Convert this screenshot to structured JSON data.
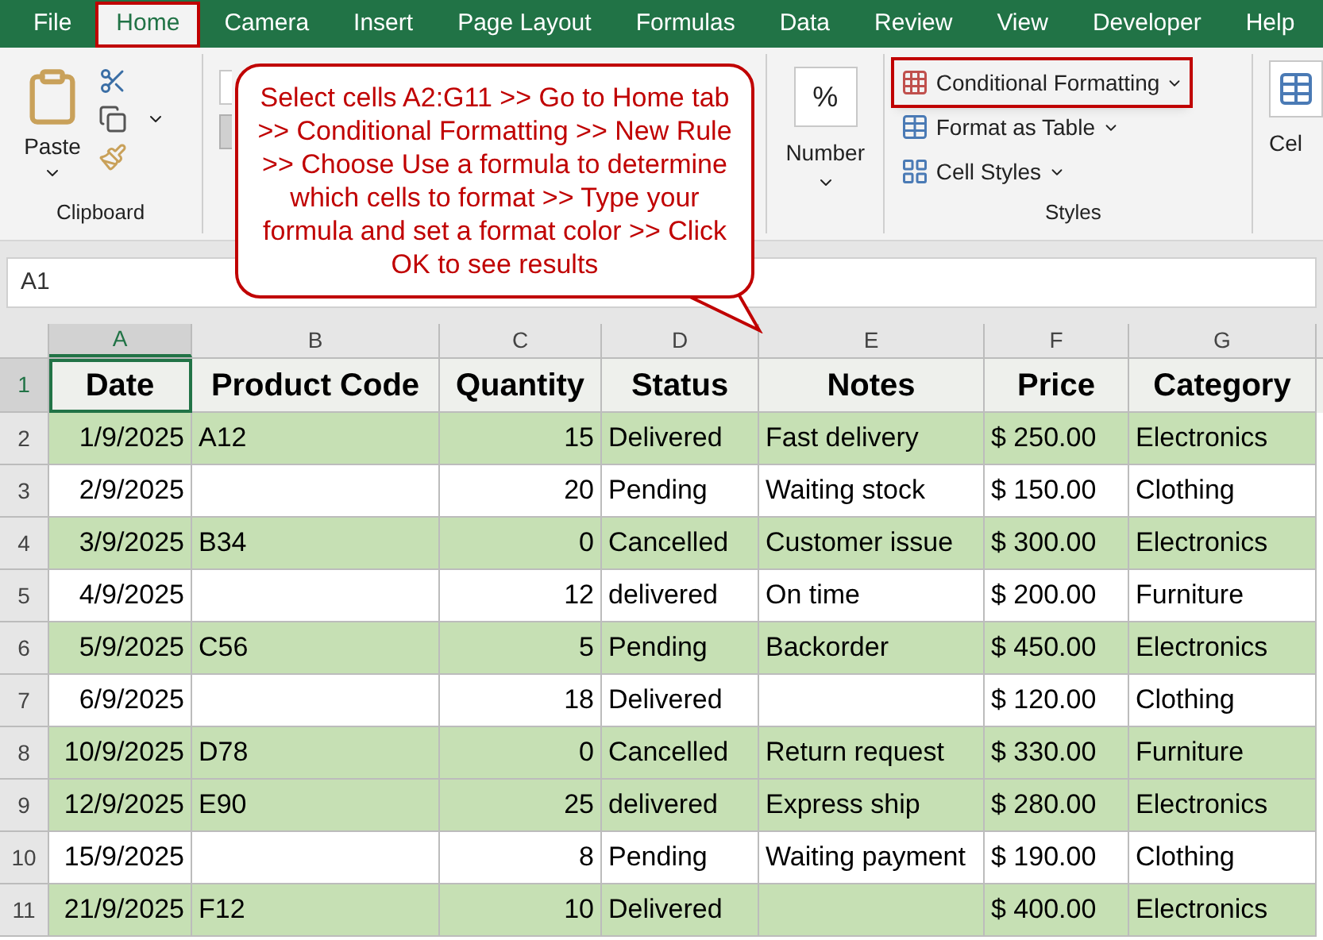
{
  "tabs": [
    {
      "label": "File",
      "selected": false,
      "annotated": false
    },
    {
      "label": "Home",
      "selected": true,
      "annotated": true
    },
    {
      "label": "Camera",
      "selected": false,
      "annotated": false
    },
    {
      "label": "Insert",
      "selected": false,
      "annotated": false
    },
    {
      "label": "Page Layout",
      "selected": false,
      "annotated": false
    },
    {
      "label": "Formulas",
      "selected": false,
      "annotated": false
    },
    {
      "label": "Data",
      "selected": false,
      "annotated": false
    },
    {
      "label": "Review",
      "selected": false,
      "annotated": false
    },
    {
      "label": "View",
      "selected": false,
      "annotated": false
    },
    {
      "label": "Developer",
      "selected": false,
      "annotated": false
    },
    {
      "label": "Help",
      "selected": false,
      "annotated": false
    }
  ],
  "ribbon": {
    "clipboard": {
      "paste": "Paste",
      "label": "Clipboard"
    },
    "number": {
      "symbol": "%",
      "label": "Number"
    },
    "styles": {
      "items": [
        {
          "label": "Conditional Formatting",
          "annotated": true
        },
        {
          "label": "Format as Table",
          "annotated": false
        },
        {
          "label": "Cell Styles",
          "annotated": false
        }
      ],
      "label": "Styles"
    },
    "cells": {
      "label": "Cel"
    }
  },
  "callout": "Select cells A2:G11 >> Go to Home tab >> Conditional Formatting >> New Rule >> Choose Use a formula to determine which cells to format >> Type your formula and set a format color >> Click OK to see results",
  "name_box": "A1",
  "sheet": {
    "columns": [
      "A",
      "B",
      "C",
      "D",
      "E",
      "F",
      "G"
    ],
    "header": {
      "number": "1",
      "cells": [
        "Date",
        "Product Code",
        "Quantity",
        "Status",
        "Notes",
        "Price",
        "Category"
      ]
    },
    "rows": [
      {
        "number": "2",
        "highlighted": true,
        "cells": [
          "1/9/2025",
          "A12",
          "15",
          "Delivered",
          "Fast delivery",
          "$ 250.00",
          "Electronics"
        ]
      },
      {
        "number": "3",
        "highlighted": false,
        "cells": [
          "2/9/2025",
          "",
          "20",
          "Pending",
          "Waiting stock",
          "$ 150.00",
          "Clothing"
        ]
      },
      {
        "number": "4",
        "highlighted": true,
        "cells": [
          "3/9/2025",
          "B34",
          "0",
          "Cancelled",
          "Customer issue",
          "$ 300.00",
          "Electronics"
        ]
      },
      {
        "number": "5",
        "highlighted": false,
        "cells": [
          "4/9/2025",
          "",
          "12",
          "delivered",
          "On time",
          "$ 200.00",
          "Furniture"
        ]
      },
      {
        "number": "6",
        "highlighted": true,
        "cells": [
          "5/9/2025",
          "C56",
          "5",
          "Pending",
          "Backorder",
          "$ 450.00",
          "Electronics"
        ]
      },
      {
        "number": "7",
        "highlighted": false,
        "cells": [
          "6/9/2025",
          "",
          "18",
          "Delivered",
          "",
          "$ 120.00",
          "Clothing"
        ]
      },
      {
        "number": "8",
        "highlighted": true,
        "cells": [
          "10/9/2025",
          "D78",
          "0",
          "Cancelled",
          "Return request",
          "$ 330.00",
          "Furniture"
        ]
      },
      {
        "number": "9",
        "highlighted": true,
        "cells": [
          "12/9/2025",
          "E90",
          "25",
          "delivered",
          "Express ship",
          "$ 280.00",
          "Electronics"
        ]
      },
      {
        "number": "10",
        "highlighted": false,
        "cells": [
          "15/9/2025",
          "",
          "8",
          "Pending",
          "Waiting payment",
          "$ 190.00",
          "Clothing"
        ]
      },
      {
        "number": "11",
        "highlighted": true,
        "cells": [
          "21/9/2025",
          "F12",
          "10",
          "Delivered",
          "",
          "$ 400.00",
          "Electronics"
        ]
      }
    ]
  }
}
